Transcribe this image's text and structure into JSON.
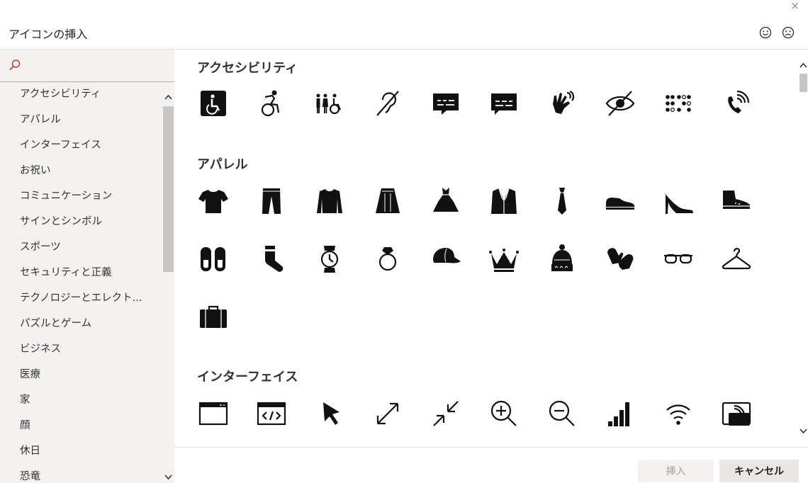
{
  "window": {
    "title": "アイコンの挿入",
    "close_glyph": "×",
    "feedback_icons": [
      "smile-icon",
      "frown-icon"
    ]
  },
  "search": {
    "placeholder": "",
    "value": ""
  },
  "sidebar": {
    "categories": [
      "アクセシビリティ",
      "アパレル",
      "インターフェイス",
      "お祝い",
      "コミュニケーション",
      "サインとシンボル",
      "スポーツ",
      "セキュリティと正義",
      "テクノロジーとエレクト...",
      "パズルとゲーム",
      "ビジネス",
      "医療",
      "家",
      "顔",
      "休日",
      "恐竜"
    ]
  },
  "sections": [
    {
      "title": "アクセシビリティ",
      "icons": [
        "accessible-icon",
        "active-wheelchair-icon",
        "family-wheelchair-icon",
        "hearing-impaired-icon",
        "closed-captioning-icon",
        "subtitles-icon",
        "sign-language-icon",
        "visually-impaired-icon",
        "braille-icon",
        "volume-control-phone-icon"
      ]
    },
    {
      "title": "アパレル",
      "icons": [
        "tshirt-icon",
        "pants-icon",
        "sweater-icon",
        "skirt-icon",
        "dress-icon",
        "suit-jacket-icon",
        "tie-icon",
        "dress-shoe-icon",
        "high-heel-icon",
        "sneaker-icon",
        "slippers-icon",
        "sock-icon",
        "wristwatch-icon",
        "ring-icon",
        "baseball-cap-icon",
        "crown-icon",
        "winter-hat-icon",
        "mittens-icon",
        "glasses-icon",
        "clothes-hanger-icon",
        "briefcase-icon"
      ]
    },
    {
      "title": "インターフェイス",
      "icons": [
        "browser-window-icon",
        "browser-code-icon",
        "cursor-arrow-icon",
        "expand-arrows-icon",
        "collapse-arrows-icon",
        "zoom-in-icon",
        "zoom-out-icon",
        "signal-bars-icon",
        "wifi-icon",
        "contactless-screen-icon"
      ]
    }
  ],
  "footer": {
    "insert_label": "挿入",
    "cancel_label": "キャンセル"
  },
  "colors": {
    "sidebar_bg": "#f3f2f1",
    "scroll_thumb": "#c8c6c4",
    "disabled_text": "#a19f9d"
  }
}
